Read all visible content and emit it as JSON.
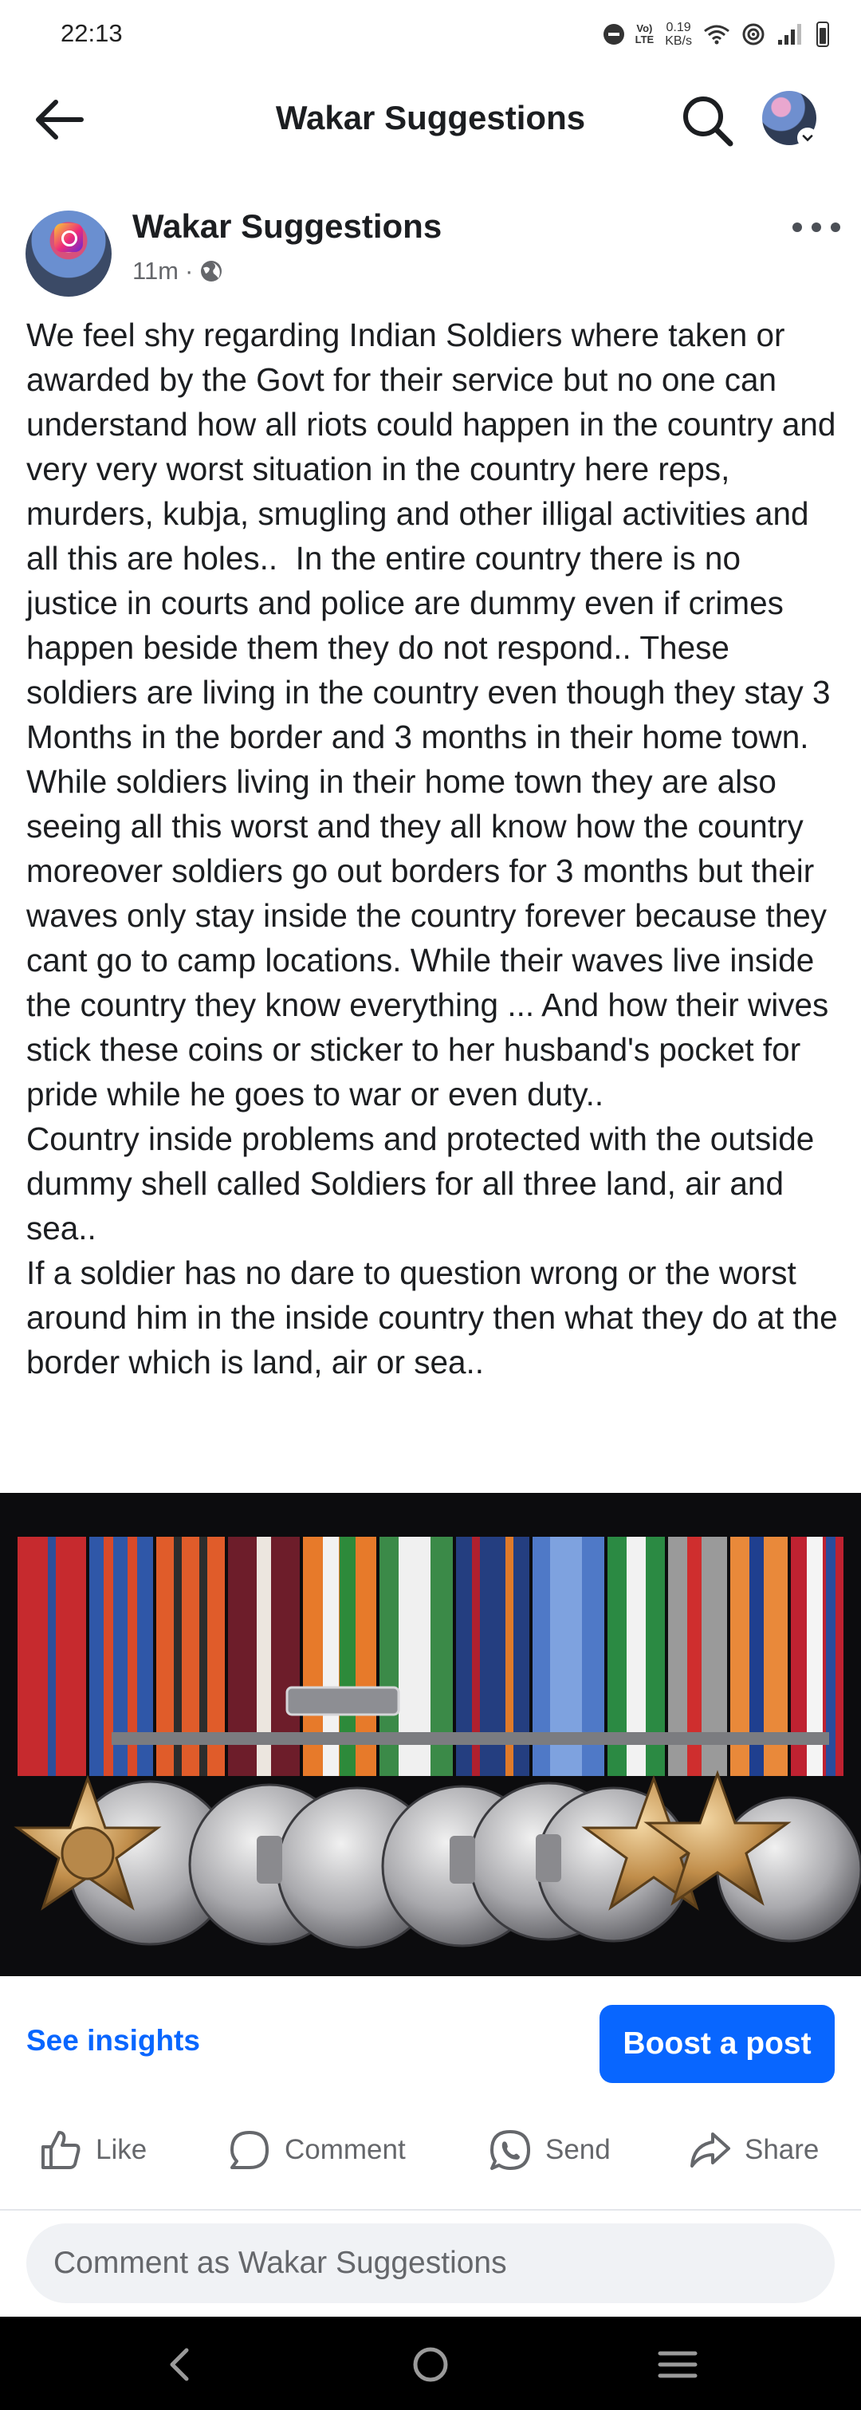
{
  "status_bar": {
    "time": "22:13",
    "network_label_top": "Vo)",
    "network_label_bottom": "LTE",
    "data_rate_value": "0.19",
    "data_rate_unit": "KB/s"
  },
  "app_bar": {
    "title": "Wakar Suggestions",
    "back_icon": "arrow-left-icon",
    "search_icon": "search-icon"
  },
  "post": {
    "author": "Wakar Suggestions",
    "time_ago": "11m",
    "separator": "·",
    "privacy_icon": "globe-icon",
    "paragraphs": [
      "We feel shy regarding Indian Soldiers where taken or awarded by the Govt for their service but no one can understand how all riots could happen in the country and very very worst situation in the country here reps, murders, kubja, smugling and other illigal activities and all this are holes..  In the entire country there is no justice in courts and police are dummy even if crimes happen beside them they do not respond.. These soldiers are living in the country even though they stay 3 Months in the border and 3 months in their home town. While soldiers living in their home town they are also seeing all this worst and they all know how the country moreover soldiers go out borders for 3 months but their waves only stay inside the country forever because they cant go to camp locations. While their waves live inside the country they know everything ... And how their wives stick these coins or sticker to her husband's pocket for pride while he goes to war or even duty..",
      "Country inside problems and protected with the outside dummy shell called Soldiers for all three land, air and sea..",
      "If a soldier has no dare to question wrong or the worst around him in the inside country then what they do at the border which is land, air or sea.."
    ]
  },
  "post_actions": {
    "insights_label": "See insights",
    "boost_label": "Boost a post",
    "like_label": "Like",
    "comment_label": "Comment",
    "send_label": "Send",
    "share_label": "Share"
  },
  "comment": {
    "placeholder": "Comment as Wakar Suggestions"
  },
  "colors": {
    "accent": "#0866ff",
    "text_primary": "#1c1e21",
    "text_secondary": "#65676b",
    "comment_bg": "#f0f2f5"
  }
}
